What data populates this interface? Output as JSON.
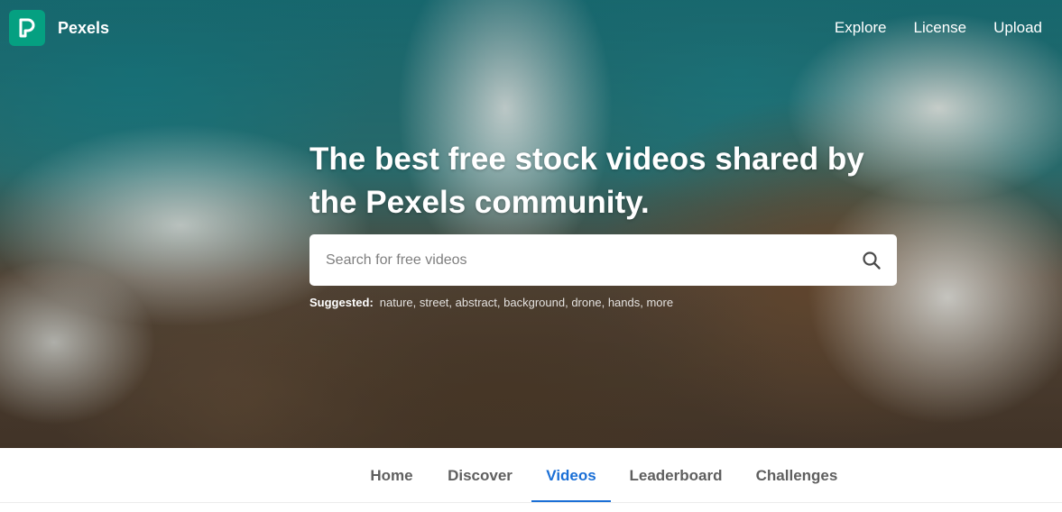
{
  "brand": {
    "name": "Pexels",
    "logo_color": "#05a081"
  },
  "nav": {
    "items": [
      "Explore",
      "License",
      "Upload"
    ]
  },
  "hero": {
    "headline": "The best free stock videos shared by the Pexels community.",
    "search": {
      "placeholder": "Search for free videos",
      "value": "",
      "icon": "search-icon"
    },
    "suggested": {
      "label": "Suggested:",
      "tags": [
        "nature",
        "street",
        "abstract",
        "background",
        "drone",
        "hands",
        "more"
      ]
    }
  },
  "tabs": {
    "items": [
      "Home",
      "Discover",
      "Videos",
      "Leaderboard",
      "Challenges"
    ],
    "active": "Videos",
    "accent": "#1a6fd6"
  }
}
